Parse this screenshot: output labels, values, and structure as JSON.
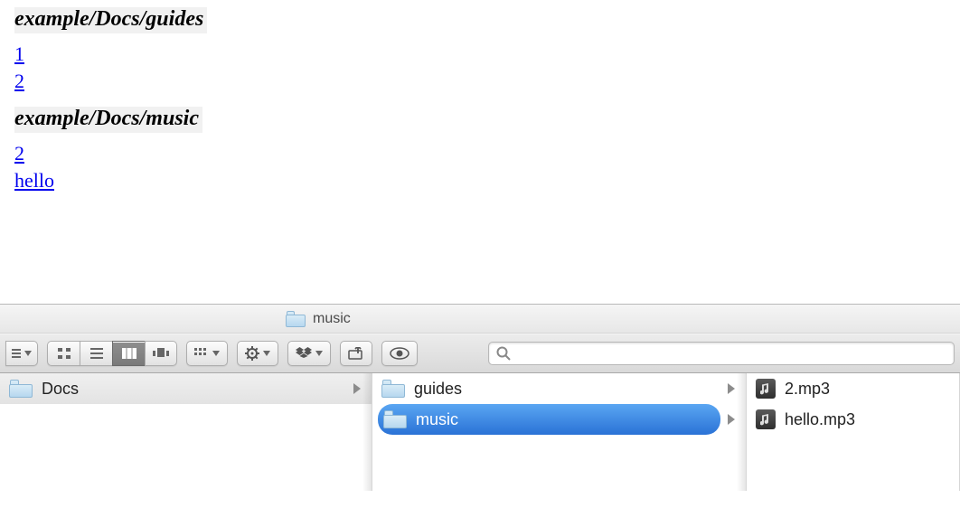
{
  "doc": {
    "sections": [
      {
        "heading": "example/Docs/guides",
        "links": [
          "1",
          "2"
        ]
      },
      {
        "heading": "example/Docs/music",
        "links": [
          "2",
          "hello"
        ]
      }
    ]
  },
  "finder": {
    "title": "music",
    "search_placeholder": "",
    "columns": [
      {
        "items": [
          {
            "name": "Docs",
            "type": "folder",
            "selected": "light",
            "has_children": true
          }
        ]
      },
      {
        "items": [
          {
            "name": "guides",
            "type": "folder",
            "selected": "none",
            "has_children": true
          },
          {
            "name": "music",
            "type": "folder",
            "selected": "blue",
            "has_children": true
          }
        ]
      },
      {
        "items": [
          {
            "name": "2.mp3",
            "type": "audio",
            "selected": "none",
            "has_children": false
          },
          {
            "name": "hello.mp3",
            "type": "audio",
            "selected": "none",
            "has_children": false
          }
        ]
      }
    ]
  }
}
